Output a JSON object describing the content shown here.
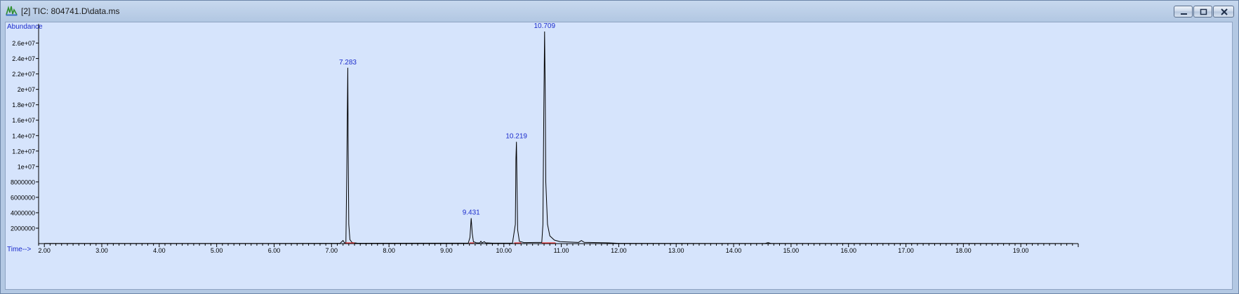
{
  "window": {
    "title": "[2] TIC: 804741.D\\data.ms",
    "app_icon": "chromatogram-app-icon",
    "buttons": [
      "minimize-icon",
      "maximize-icon",
      "close-icon"
    ]
  },
  "colors": {
    "plot_background": "#d6e4fc",
    "trace": "#000000",
    "axis_label_text": "#1c2ccc",
    "peak_label_text": "#1c2ccc",
    "baseline_marks": "#e03030"
  },
  "chart_data": {
    "type": "line",
    "title": "",
    "ylabel": "Abundance",
    "xlabel": "Time-->",
    "xlim": [
      1.9,
      20.0
    ],
    "ylim": [
      0,
      28500000
    ],
    "x_ticks": [
      "2.00",
      "3.00",
      "4.00",
      "5.00",
      "6.00",
      "7.00",
      "8.00",
      "9.00",
      "10.00",
      "11.00",
      "12.00",
      "13.00",
      "14.00",
      "15.00",
      "16.00",
      "17.00",
      "18.00",
      "19.00"
    ],
    "y_ticks": [
      {
        "value": 2000000,
        "label": "2000000"
      },
      {
        "value": 4000000,
        "label": "4000000"
      },
      {
        "value": 6000000,
        "label": "6000000"
      },
      {
        "value": 8000000,
        "label": "8000000"
      },
      {
        "value": 10000000,
        "label": "1e+07"
      },
      {
        "value": 12000000,
        "label": "1.2e+07"
      },
      {
        "value": 14000000,
        "label": "1.4e+07"
      },
      {
        "value": 16000000,
        "label": "1.6e+07"
      },
      {
        "value": 18000000,
        "label": "1.8e+07"
      },
      {
        "value": 20000000,
        "label": "2e+07"
      },
      {
        "value": 22000000,
        "label": "2.2e+07"
      },
      {
        "value": 24000000,
        "label": "2.4e+07"
      },
      {
        "value": 26000000,
        "label": "2.6e+07"
      }
    ],
    "peaks": [
      {
        "label": "7.283",
        "rt": 7.283,
        "abundance": 22800000
      },
      {
        "label": "9.431",
        "rt": 9.431,
        "abundance": 3300000
      },
      {
        "label": "10.219",
        "rt": 10.219,
        "abundance": 13200000
      },
      {
        "label": "10.709",
        "rt": 10.709,
        "abundance": 27500000
      }
    ],
    "series": [
      {
        "points": [
          [
            2.0,
            20000
          ],
          [
            6.8,
            30000
          ],
          [
            7.15,
            40000
          ],
          [
            7.2,
            400000
          ],
          [
            7.23,
            60000
          ],
          [
            7.25,
            150000
          ],
          [
            7.265,
            9000000
          ],
          [
            7.275,
            17000000
          ],
          [
            7.283,
            22800000
          ],
          [
            7.29,
            12000000
          ],
          [
            7.3,
            2500000
          ],
          [
            7.32,
            500000
          ],
          [
            7.36,
            120000
          ],
          [
            7.45,
            50000
          ],
          [
            9.38,
            60000
          ],
          [
            9.41,
            800000
          ],
          [
            9.431,
            3300000
          ],
          [
            9.45,
            1300000
          ],
          [
            9.47,
            250000
          ],
          [
            9.52,
            100000
          ],
          [
            9.58,
            80000
          ],
          [
            9.6,
            300000
          ],
          [
            9.62,
            90000
          ],
          [
            9.66,
            250000
          ],
          [
            9.68,
            100000
          ],
          [
            9.8,
            60000
          ],
          [
            10.15,
            60000
          ],
          [
            10.2,
            2500000
          ],
          [
            10.21,
            11000000
          ],
          [
            10.219,
            13200000
          ],
          [
            10.23,
            7000000
          ],
          [
            10.24,
            1800000
          ],
          [
            10.27,
            300000
          ],
          [
            10.35,
            130000
          ],
          [
            10.66,
            150000
          ],
          [
            10.68,
            2500000
          ],
          [
            10.695,
            17000000
          ],
          [
            10.709,
            27500000
          ],
          [
            10.72,
            20000000
          ],
          [
            10.73,
            8000000
          ],
          [
            10.76,
            2500000
          ],
          [
            10.8,
            1000000
          ],
          [
            10.88,
            450000
          ],
          [
            10.98,
            250000
          ],
          [
            11.3,
            150000
          ],
          [
            11.35,
            400000
          ],
          [
            11.4,
            160000
          ],
          [
            11.8,
            100000
          ],
          [
            12.0,
            30000
          ],
          [
            14.55,
            25000
          ],
          [
            14.6,
            120000
          ],
          [
            14.65,
            25000
          ],
          [
            19.9,
            15000
          ]
        ]
      }
    ],
    "baseline_segments": [
      [
        7.24,
        7.4
      ],
      [
        9.4,
        9.48
      ],
      [
        10.18,
        10.3
      ],
      [
        10.66,
        10.9
      ]
    ],
    "grid": false,
    "legend": "none"
  }
}
